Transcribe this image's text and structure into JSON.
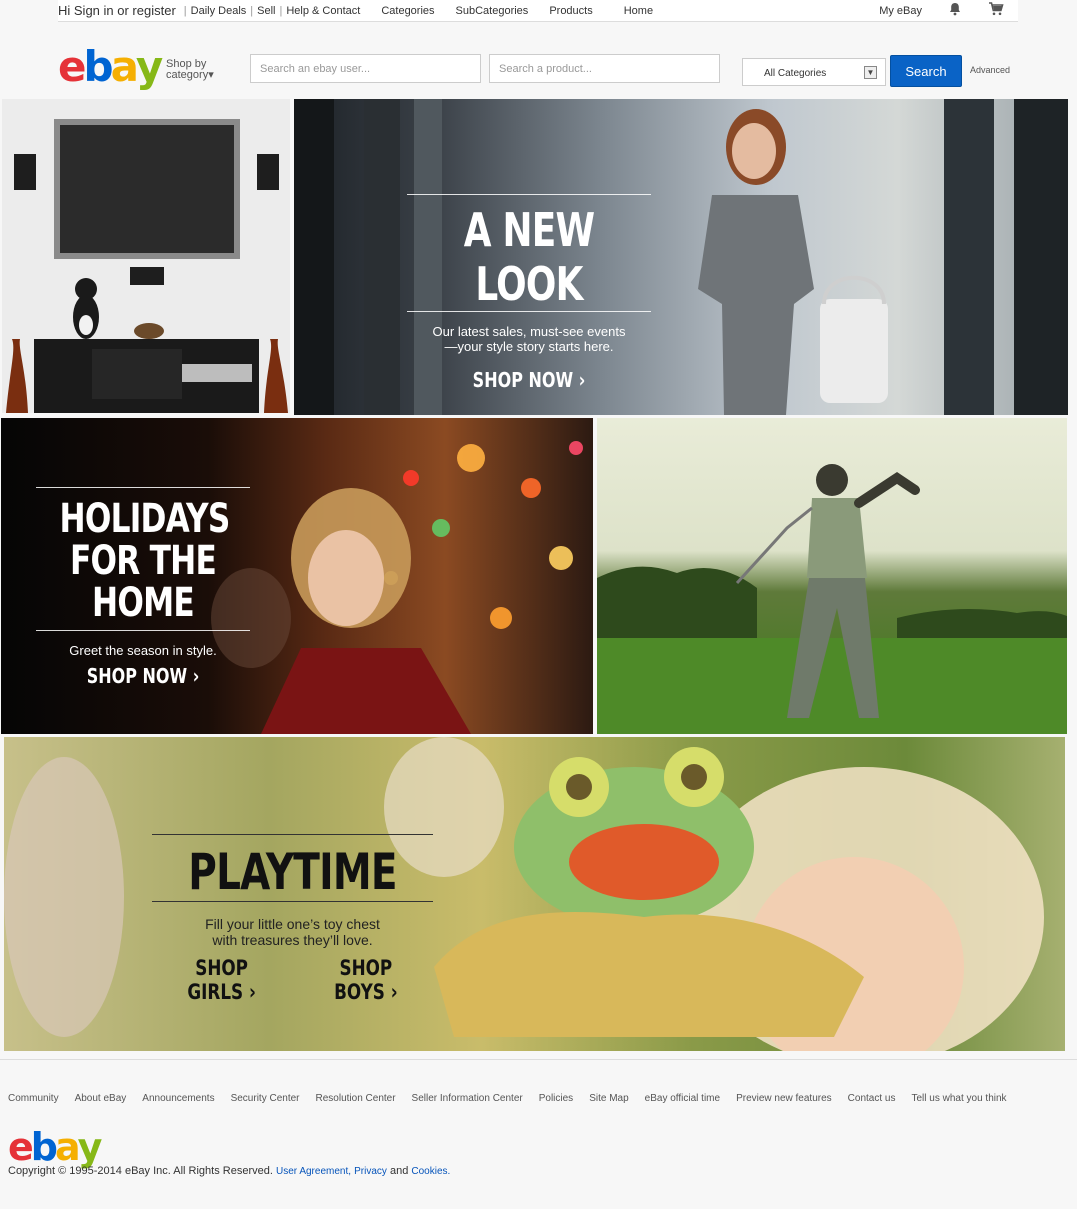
{
  "topnav": {
    "greeting": "Hi Sign in or register",
    "links": [
      "Daily Deals",
      "Sell",
      "Help & Contact",
      "Categories",
      "SubCategories",
      "Products",
      "Home"
    ],
    "my_ebay": "My eBay"
  },
  "brand": {
    "logo_letters": [
      "e",
      "b",
      "a",
      "y"
    ]
  },
  "header": {
    "shop_by_line1": "Shop by",
    "shop_by_line2": "category▾",
    "search_user_placeholder": "Search an ebay user...",
    "search_product_placeholder": "Search a product...",
    "category_selected": "All Categories",
    "search_button": "Search",
    "advanced_link": "Advanced"
  },
  "banners": {
    "new_look": {
      "headline": "A NEW LOOK",
      "sub_line1": "Our latest sales, must-see events",
      "sub_line2": "—your style story starts here.",
      "cta": "SHOP NOW ›"
    },
    "holidays": {
      "headline_line1": "HOLIDAYS",
      "headline_line2": "FOR THE HOME",
      "sub": "Greet the season in style.",
      "cta": "SHOP NOW ›"
    },
    "playtime": {
      "headline": "PLAYTIME",
      "sub_line1": "Fill your little one’s toy chest",
      "sub_line2": "with treasures they’ll love.",
      "cta_girls": "SHOP GIRLS ›",
      "cta_boys": "SHOP BOYS ›"
    }
  },
  "footer": {
    "links": [
      "Community",
      "About eBay",
      "Announcements",
      "Security Center",
      "Resolution Center",
      "Seller Information Center",
      "Policies",
      "Site Map",
      "eBay official time",
      "Preview new features",
      "Contact us",
      "Tell us what you think"
    ],
    "copyright": "Copyright © 1995-2014 eBay Inc. All Rights Reserved.",
    "user_agreement": "User Agreement,",
    "privacy": "Privacy",
    "and": "and",
    "cookies": "Cookies."
  },
  "colors": {
    "search_button": "#0a63c6",
    "logo_e": "#e53238",
    "logo_b": "#0064d2",
    "logo_a": "#f5af02",
    "logo_y": "#86b817"
  }
}
